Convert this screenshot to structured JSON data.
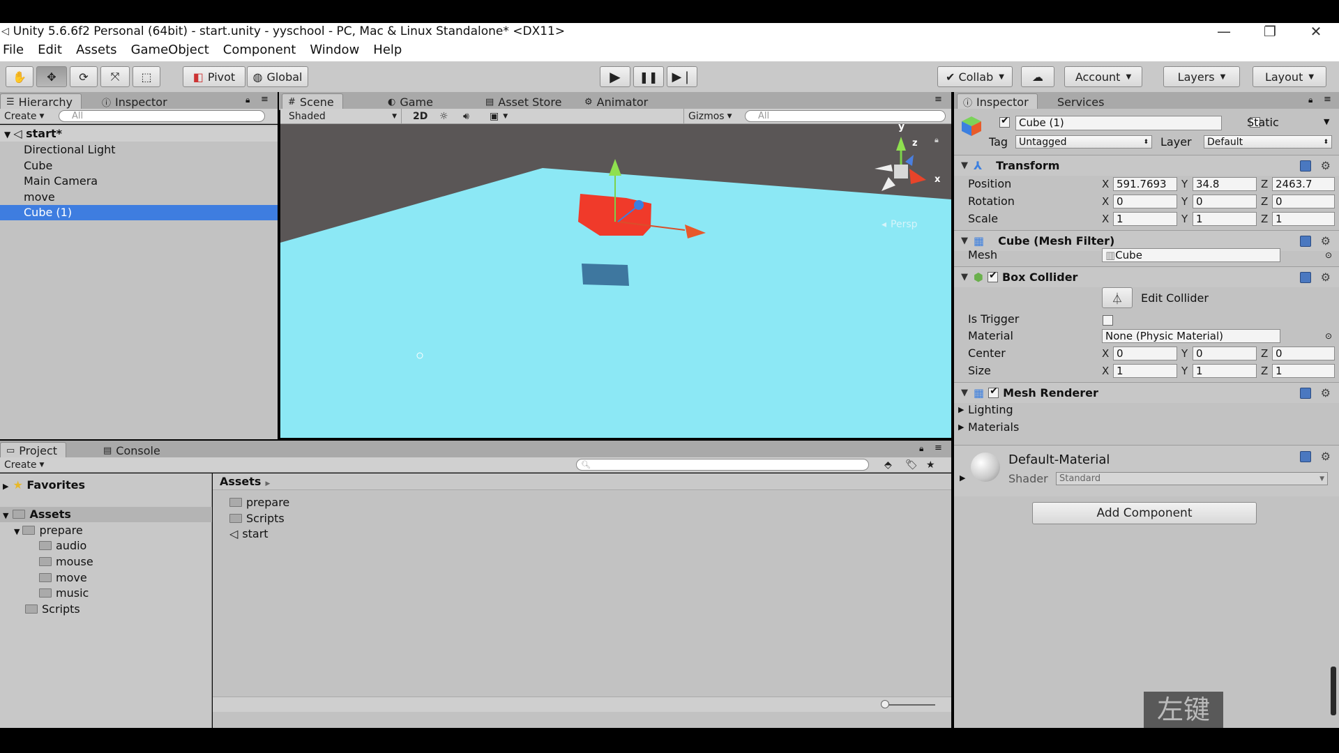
{
  "window": {
    "title": "Unity 5.6.6f2 Personal (64bit) - start.unity - yyschool - PC, Mac & Linux Standalone* <DX11>",
    "minimize": "—",
    "maximize": "❐",
    "close": "✕"
  },
  "menu": [
    "File",
    "Edit",
    "Assets",
    "GameObject",
    "Component",
    "Window",
    "Help"
  ],
  "toolbar": {
    "pivot": "Pivot",
    "global": "Global",
    "collab": "Collab",
    "account": "Account",
    "layers": "Layers",
    "layout": "Layout"
  },
  "hierarchy": {
    "tab": "Hierarchy",
    "tab2": "Inspector",
    "create": "Create",
    "search": "All",
    "scene": "start*",
    "items": [
      "Directional Light",
      "Cube",
      "Main Camera",
      "move",
      "Cube (1)"
    ]
  },
  "scene": {
    "tabs": [
      "Scene",
      "Game",
      "Asset Store",
      "Animator"
    ],
    "shading": "Shaded",
    "mode2d": "2D",
    "gizmos": "Gizmos",
    "search": "All",
    "persp": "Persp",
    "axis_y": "y",
    "axis_z": "z",
    "axis_x": "x"
  },
  "inspector": {
    "tabs": [
      "Inspector",
      "Services"
    ],
    "name": "Cube (1)",
    "static": "Static",
    "tag_label": "Tag",
    "tag": "Untagged",
    "layer_label": "Layer",
    "layer": "Default",
    "transform": {
      "title": "Transform",
      "rows": [
        {
          "label": "Position",
          "x": "591.7693",
          "y": "34.8",
          "z": "2463.7"
        },
        {
          "label": "Rotation",
          "x": "0",
          "y": "0",
          "z": "0"
        },
        {
          "label": "Scale",
          "x": "1",
          "y": "1",
          "z": "1"
        }
      ]
    },
    "meshfilter": {
      "title": "Cube (Mesh Filter)",
      "mesh_label": "Mesh",
      "mesh": "Cube"
    },
    "collider": {
      "title": "Box Collider",
      "edit": "Edit Collider",
      "trigger_label": "Is Trigger",
      "material_label": "Material",
      "material": "None (Physic Material)",
      "center": {
        "label": "Center",
        "x": "0",
        "y": "0",
        "z": "0"
      },
      "size": {
        "label": "Size",
        "x": "1",
        "y": "1",
        "z": "1"
      }
    },
    "renderer": {
      "title": "Mesh Renderer",
      "lighting": "Lighting",
      "materials": "Materials"
    },
    "material": {
      "name": "Default-Material",
      "shader_label": "Shader",
      "shader": "Standard"
    },
    "add_component": "Add Component",
    "axes": [
      "X",
      "Y",
      "Z"
    ]
  },
  "project": {
    "tab": "Project",
    "tab2": "Console",
    "create": "Create",
    "favorites": "Favorites",
    "assets": "Assets",
    "tree": [
      {
        "name": "prepare",
        "level": 1
      },
      {
        "name": "audio",
        "level": 2
      },
      {
        "name": "mouse",
        "level": 2
      },
      {
        "name": "move",
        "level": 2
      },
      {
        "name": "music",
        "level": 2
      },
      {
        "name": "Scripts",
        "level": 1
      }
    ],
    "breadcrumb": "Assets",
    "files": [
      "prepare",
      "Scripts",
      "start"
    ]
  },
  "overlay": "左键",
  "colors": {
    "selection": "#3e7de0",
    "scene_floor": "#8ce8f5",
    "cube": "#f03a2a"
  }
}
